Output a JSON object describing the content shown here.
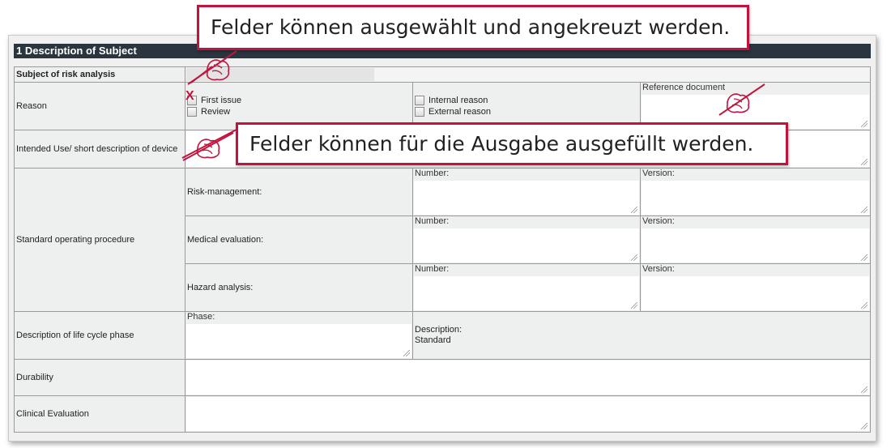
{
  "section": {
    "title": "1 Description of Subject"
  },
  "subject_row": {
    "label": "Subject of risk analysis",
    "value": ""
  },
  "reason_row": {
    "label": "Reason",
    "options": [
      {
        "label": "First issue",
        "checked": true
      },
      {
        "label": "Review",
        "checked": false
      },
      {
        "label": "Internal reason",
        "checked": false
      },
      {
        "label": "External reason",
        "checked": false
      }
    ],
    "reference_label": "Reference document",
    "check_mark": "X"
  },
  "intended_use_row": {
    "label": "Intended Use/ short description of device",
    "value": ""
  },
  "sop_row": {
    "label": "Standard operating procedure",
    "items": [
      {
        "label": "Risk-management:",
        "number_label": "Number:",
        "version_label": "Version:"
      },
      {
        "label": "Medical evaluation:",
        "number_label": "Number:",
        "version_label": "Version:"
      },
      {
        "label": "Hazard analysis:",
        "number_label": "Number:",
        "version_label": "Version:"
      }
    ]
  },
  "lifecycle_row": {
    "label": "Description of life cycle phase",
    "phase_label": "Phase:",
    "description_label": "Description:",
    "description_value": "Standard"
  },
  "durability_row": {
    "label": "Durability"
  },
  "clinical_row": {
    "label": "Clinical Evaluation"
  },
  "callouts": {
    "top": "Felder können ausgewählt und angekreuzt werden.",
    "middle": "Felder können für die Ausgabe ausgefüllt werden."
  },
  "colors": {
    "accent": "#c0143c",
    "header": "#2a3540"
  },
  "icons": [
    "pen-hand-icon",
    "resize-grip-icon",
    "checkbox-icon"
  ]
}
